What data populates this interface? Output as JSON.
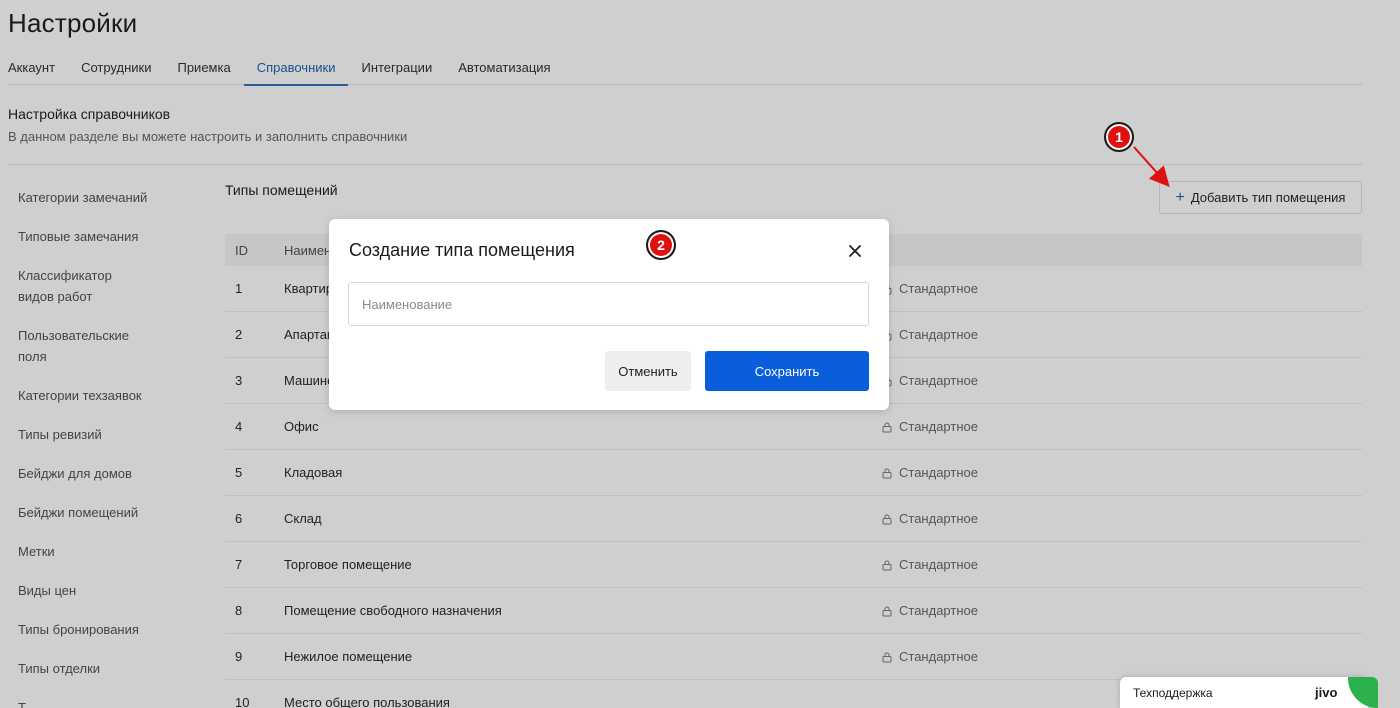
{
  "page": {
    "title": "Настройки"
  },
  "tabs": [
    {
      "label": "Аккаунт"
    },
    {
      "label": "Сотрудники"
    },
    {
      "label": "Приемка"
    },
    {
      "label": "Справочники"
    },
    {
      "label": "Интеграции"
    },
    {
      "label": "Автоматизация"
    }
  ],
  "section": {
    "title": "Настройка справочников",
    "description": "В данном разделе вы можете настроить и заполнить справочники"
  },
  "sidebar": {
    "items": [
      {
        "label": "Категории замечаний"
      },
      {
        "label": "Типовые замечания"
      },
      {
        "label": "Классификатор видов работ"
      },
      {
        "label": "Пользовательские поля"
      },
      {
        "label": "Категории техзаявок"
      },
      {
        "label": "Типы ревизий"
      },
      {
        "label": "Бейджи для домов"
      },
      {
        "label": "Бейджи помещений"
      },
      {
        "label": "Метки"
      },
      {
        "label": "Виды цен"
      },
      {
        "label": "Типы бронирования"
      },
      {
        "label": "Типы отделки"
      },
      {
        "label": "Т..."
      }
    ]
  },
  "content": {
    "title": "Типы помещений",
    "add_button_label": "Добавить тип помещения",
    "table": {
      "headers": {
        "id": "ID",
        "name": "Наимен"
      },
      "rows": [
        {
          "id": "1",
          "name": "Квартир",
          "type": "Стандартное"
        },
        {
          "id": "2",
          "name": "Апартам",
          "type": "Стандартное"
        },
        {
          "id": "3",
          "name": "Машино",
          "type": "Стандартное"
        },
        {
          "id": "4",
          "name": "Офис",
          "type": "Стандартное"
        },
        {
          "id": "5",
          "name": "Кладовая",
          "type": "Стандартное"
        },
        {
          "id": "6",
          "name": "Склад",
          "type": "Стандартное"
        },
        {
          "id": "7",
          "name": "Торговое помещение",
          "type": "Стандартное"
        },
        {
          "id": "8",
          "name": "Помещение свободного назначения",
          "type": "Стандартное"
        },
        {
          "id": "9",
          "name": "Нежилое помещение",
          "type": "Стандартное"
        },
        {
          "id": "10",
          "name": "Место общего пользования",
          "type": ""
        }
      ]
    }
  },
  "modal": {
    "title": "Создание типа помещения",
    "input_placeholder": "Наименование",
    "input_value": "",
    "cancel_label": "Отменить",
    "save_label": "Сохранить"
  },
  "annotations": {
    "marker_1": "1",
    "marker_2": "2"
  },
  "support_widget": {
    "label": "Техподдержка",
    "logo_text": "jivo"
  },
  "colors": {
    "primary": "#0a5ddb",
    "active_tab": "#1c4f8f",
    "marker": "#e01010",
    "overlay": "#cfcfcf",
    "jivo_green": "#2bb24c"
  }
}
